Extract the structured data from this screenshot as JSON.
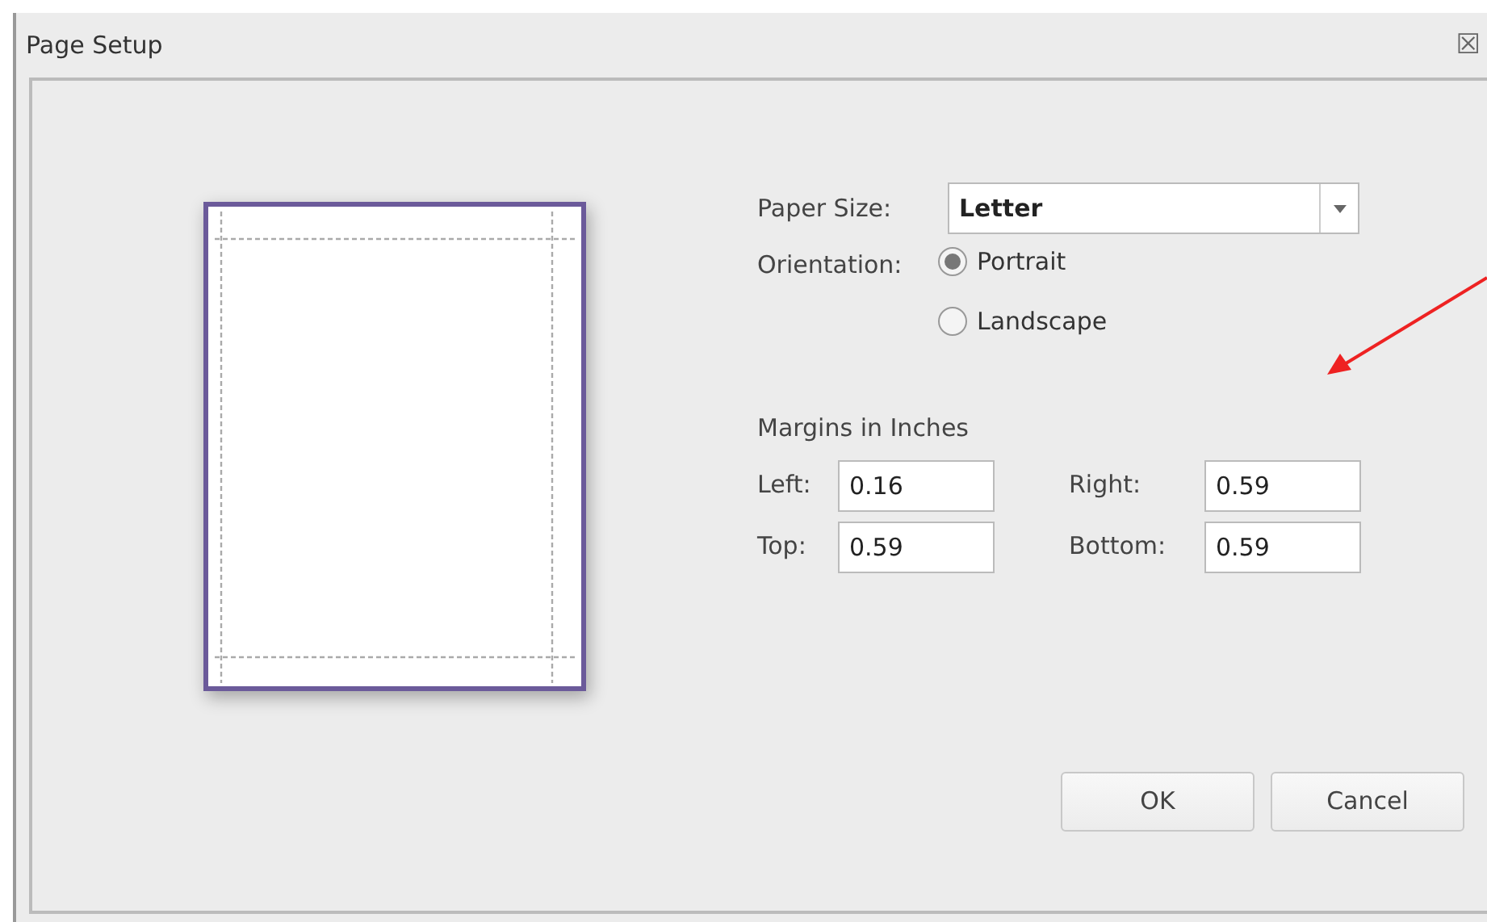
{
  "window": {
    "title": "Page Setup",
    "close_glyph": "☒"
  },
  "paper_size": {
    "label": "Paper Size:",
    "value": "Letter"
  },
  "orientation": {
    "label": "Orientation:",
    "options": [
      {
        "label": "Portrait",
        "selected": true
      },
      {
        "label": "Landscape",
        "selected": false
      }
    ]
  },
  "margins": {
    "heading": "Margins in Inches",
    "fields": [
      {
        "label": "Left:",
        "value": "0.16"
      },
      {
        "label": "Right:",
        "value": "0.59"
      },
      {
        "label": "Top:",
        "value": "0.59"
      },
      {
        "label": "Bottom:",
        "value": "0.59"
      }
    ]
  },
  "buttons": [
    "OK",
    "Cancel"
  ]
}
